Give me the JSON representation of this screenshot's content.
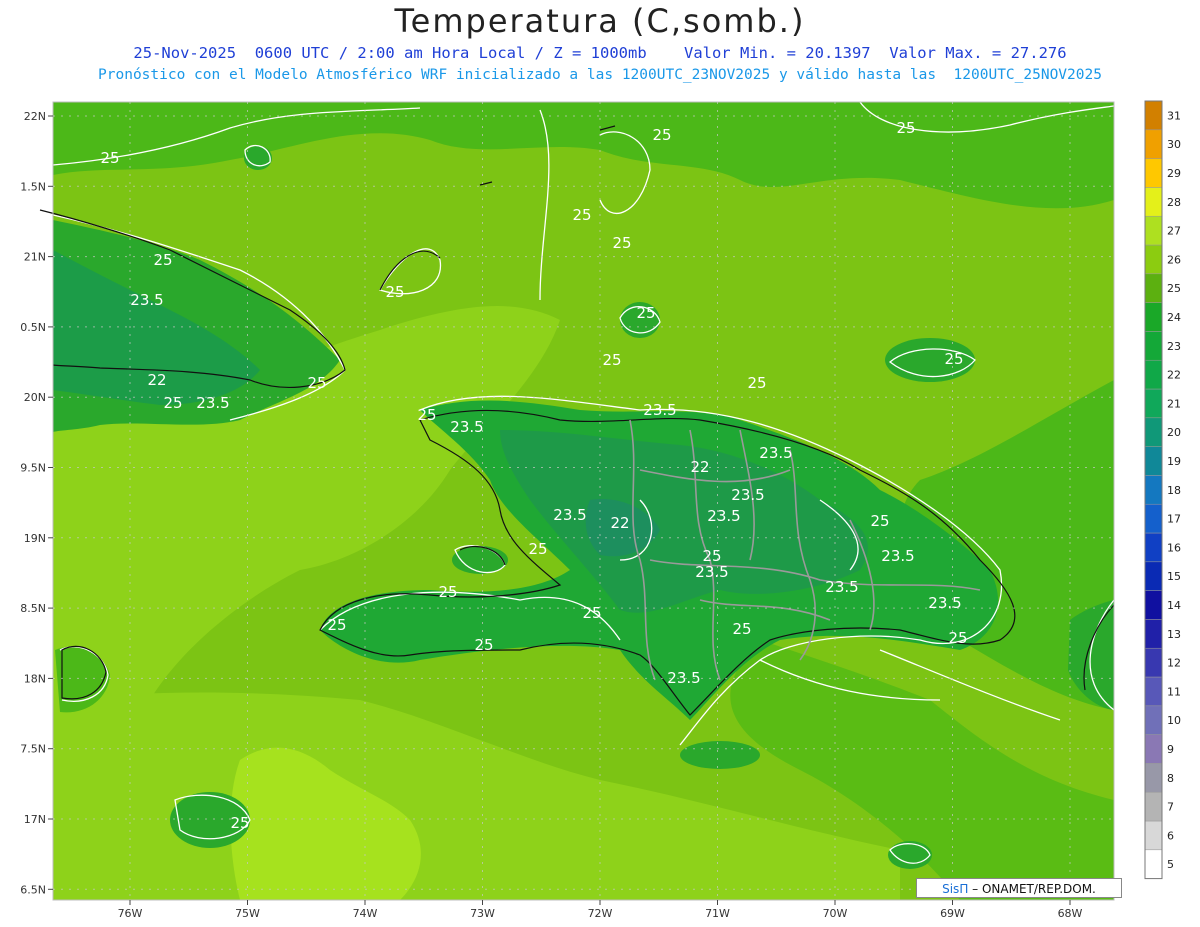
{
  "header": {
    "title": "Temperatura (C,somb.)",
    "subtitle1": "25-Nov-2025  0600 UTC / 2:00 am Hora Local / Z = 1000mb    Valor Min. = 20.1397  Valor Max. = 27.276",
    "subtitle2": "Pronóstico con el Modelo Atmosférico WRF inicializado a las 1200UTC_23NOV2025 y válido hasta las  1200UTC_25NOV2025"
  },
  "axes": {
    "lon_labels": [
      "76W",
      "75W",
      "74W",
      "73W",
      "72W",
      "71W",
      "70W",
      "69W",
      "68W"
    ],
    "lat_labels": [
      "22N",
      "1.5N",
      "21N",
      "0.5N",
      "20N",
      "9.5N",
      "19N",
      "8.5N",
      "18N",
      "7.5N",
      "17N",
      "6.5N"
    ]
  },
  "colorbar": {
    "labels": [
      "5",
      "6",
      "7",
      "8",
      "9",
      "10",
      "11",
      "12",
      "13",
      "14",
      "15",
      "16",
      "17",
      "18",
      "19",
      "20",
      "21",
      "22",
      "23",
      "24",
      "25",
      "26",
      "27",
      "28",
      "29",
      "30",
      "31"
    ],
    "colors": [
      "#ffffff",
      "#d8d8d8",
      "#b4b4b4",
      "#9898a8",
      "#8a78b4",
      "#7070b8",
      "#5858b8",
      "#3838b0",
      "#2020a8",
      "#1010a0",
      "#0a2ab4",
      "#1040c4",
      "#1460cc",
      "#1478c0",
      "#108898",
      "#109878",
      "#10a85a",
      "#10a848",
      "#14a838",
      "#1aa828",
      "#5cb010",
      "#8ccc10",
      "#aee020",
      "#e4f01a",
      "#ffc800",
      "#f0a000",
      "#d28000"
    ]
  },
  "contour_labels": [
    "25",
    "23.5",
    "22"
  ],
  "credit": {
    "brand": "SisΠ",
    "text": " – ONAMET/REP.DOM."
  }
}
